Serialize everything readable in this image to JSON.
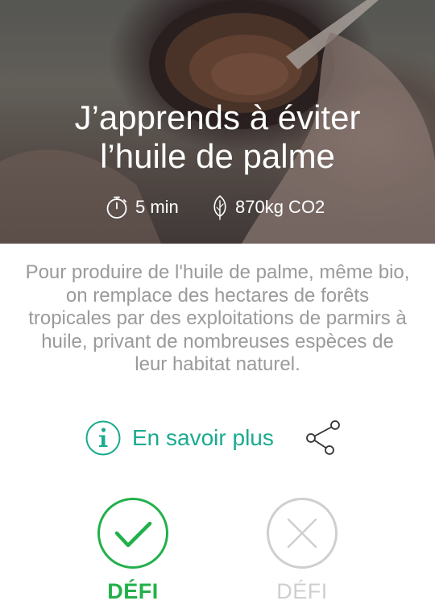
{
  "hero": {
    "title_line1": "J’apprends à éviter",
    "title_line2": "l’huile de palme",
    "duration": "5 min",
    "co2": "870kg CO2"
  },
  "description": "Pour produire de l'huile de palme, même bio, on remplace des hectares de forêts tropicales par des exploitations de parmirs à huile, privant de nombreuses espèces de leur habitat naturel.",
  "links": {
    "learn_more": "En savoir plus"
  },
  "actions": {
    "accept_label": "DÉFI",
    "decline_label": "DÉFI"
  },
  "colors": {
    "accent_teal": "#1aab8f",
    "accept_green": "#22b04a",
    "decline_gray": "#cfcfcf",
    "body_text": "#9a9a9a"
  },
  "icons": [
    "timer-icon",
    "leaf-icon",
    "info-icon",
    "share-icon",
    "check-icon",
    "close-icon"
  ]
}
